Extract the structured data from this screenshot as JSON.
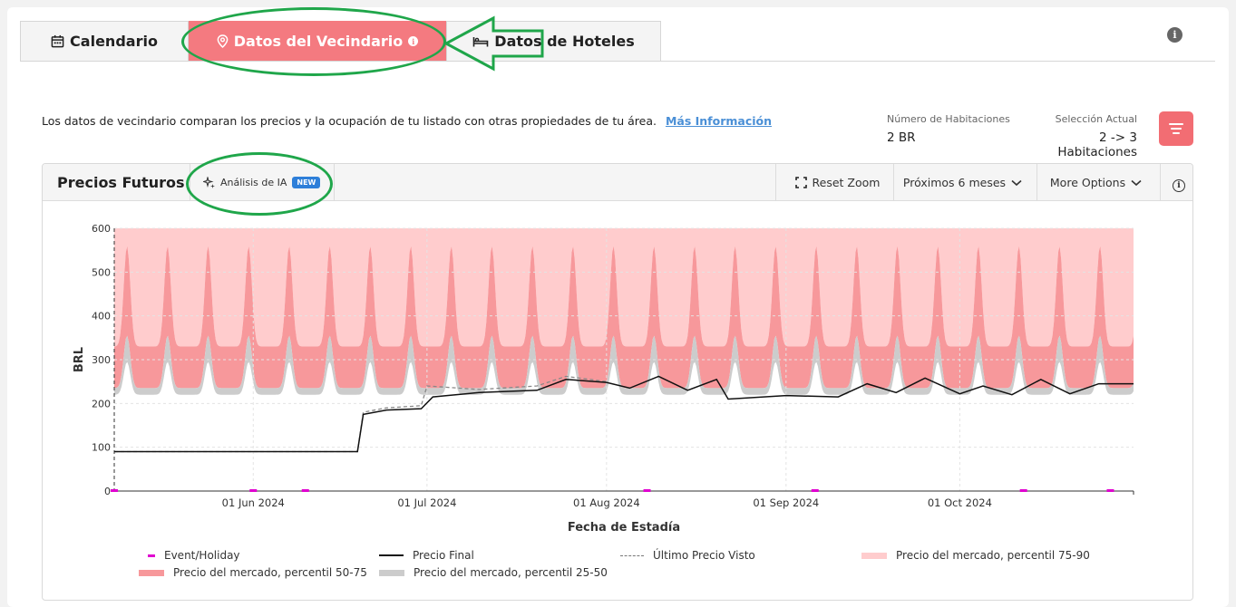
{
  "tabs": [
    {
      "label": "Calendario",
      "icon": "calendar-icon"
    },
    {
      "label": "Datos del Vecindario",
      "icon": "location-pin-icon"
    },
    {
      "label": "Datos de Hoteles",
      "icon": "bed-icon"
    }
  ],
  "description": {
    "text": "Los datos de vecindario comparan los precios y la ocupación de tu listado con otras propiedades de tu área.",
    "link": "Más Información"
  },
  "stats": {
    "rooms_label": "Número de Habitaciones",
    "rooms_value": "2 BR",
    "selection_label": "Selección Actual",
    "selection_value": "2 -> 3 Habitaciones"
  },
  "panel": {
    "title": "Precios Futuros",
    "ai_label": "Análisis de IA",
    "ai_badge": "NEW",
    "reset_zoom": "Reset Zoom",
    "range_select": "Próximos 6 meses",
    "more_options": "More Options"
  },
  "colors": {
    "accent": "#f47a80",
    "p75_90": "#ffcccd",
    "p50_75": "#f7989b",
    "p25_50": "#cccccc",
    "event": "#e000d0",
    "annotation": "#1fa64a"
  },
  "chart_data": {
    "type": "area",
    "xlabel": "Fecha de Estadía",
    "ylabel": "BRL",
    "ylim": [
      0,
      600
    ],
    "yticks": [
      0,
      100,
      200,
      300,
      400,
      500,
      600
    ],
    "x_start": "2024-05-08",
    "x_end": "2024-10-31",
    "xticks": [
      {
        "date": "2024-06-01",
        "label": "01 Jun 2024"
      },
      {
        "date": "2024-07-01",
        "label": "01 Jul 2024"
      },
      {
        "date": "2024-08-01",
        "label": "01 Aug 2024"
      },
      {
        "date": "2024-09-01",
        "label": "01 Sep 2024"
      },
      {
        "date": "2024-10-01",
        "label": "01 Oct 2024"
      }
    ],
    "grid": true,
    "legend_position": "bottom",
    "series": [
      {
        "name": "Event/Holiday",
        "style": "marker",
        "dates": [
          "2024-05-08",
          "2024-06-01",
          "2024-06-10",
          "2024-08-08",
          "2024-09-06",
          "2024-10-12",
          "2024-10-27"
        ]
      },
      {
        "name": "Precio Final",
        "style": "line",
        "points": [
          [
            "2024-05-08",
            90
          ],
          [
            "2024-06-19",
            90
          ],
          [
            "2024-06-20",
            175
          ],
          [
            "2024-06-24",
            185
          ],
          [
            "2024-06-30",
            188
          ],
          [
            "2024-07-02",
            215
          ],
          [
            "2024-07-10",
            225
          ],
          [
            "2024-07-20",
            230
          ],
          [
            "2024-07-25",
            255
          ],
          [
            "2024-08-01",
            248
          ],
          [
            "2024-08-05",
            235
          ],
          [
            "2024-08-10",
            262
          ],
          [
            "2024-08-15",
            230
          ],
          [
            "2024-08-20",
            255
          ],
          [
            "2024-08-22",
            210
          ],
          [
            "2024-09-01",
            218
          ],
          [
            "2024-09-10",
            215
          ],
          [
            "2024-09-15",
            245
          ],
          [
            "2024-09-20",
            225
          ],
          [
            "2024-09-25",
            258
          ],
          [
            "2024-10-01",
            222
          ],
          [
            "2024-10-05",
            240
          ],
          [
            "2024-10-10",
            220
          ],
          [
            "2024-10-15",
            255
          ],
          [
            "2024-10-20",
            222
          ],
          [
            "2024-10-25",
            245
          ],
          [
            "2024-10-31",
            245
          ]
        ]
      },
      {
        "name": "Último Precio Visto",
        "style": "dashed",
        "points": [
          [
            "2024-05-08",
            90
          ],
          [
            "2024-06-19",
            90
          ],
          [
            "2024-06-20",
            180
          ],
          [
            "2024-06-24",
            190
          ],
          [
            "2024-06-30",
            195
          ],
          [
            "2024-07-01",
            240
          ],
          [
            "2024-07-10",
            232
          ],
          [
            "2024-07-20",
            240
          ],
          [
            "2024-07-25",
            262
          ],
          [
            "2024-08-01",
            250
          ]
        ]
      },
      {
        "name": "Precio del mercado, percentil 75-90",
        "style": "band",
        "low": 440,
        "high": 600
      },
      {
        "name": "Precio del mercado, percentil 50-75",
        "style": "band",
        "low": 330,
        "high": 440
      },
      {
        "name": "Precio del mercado, percentil 25-50",
        "style": "band",
        "low": 225,
        "high": 330
      }
    ]
  }
}
